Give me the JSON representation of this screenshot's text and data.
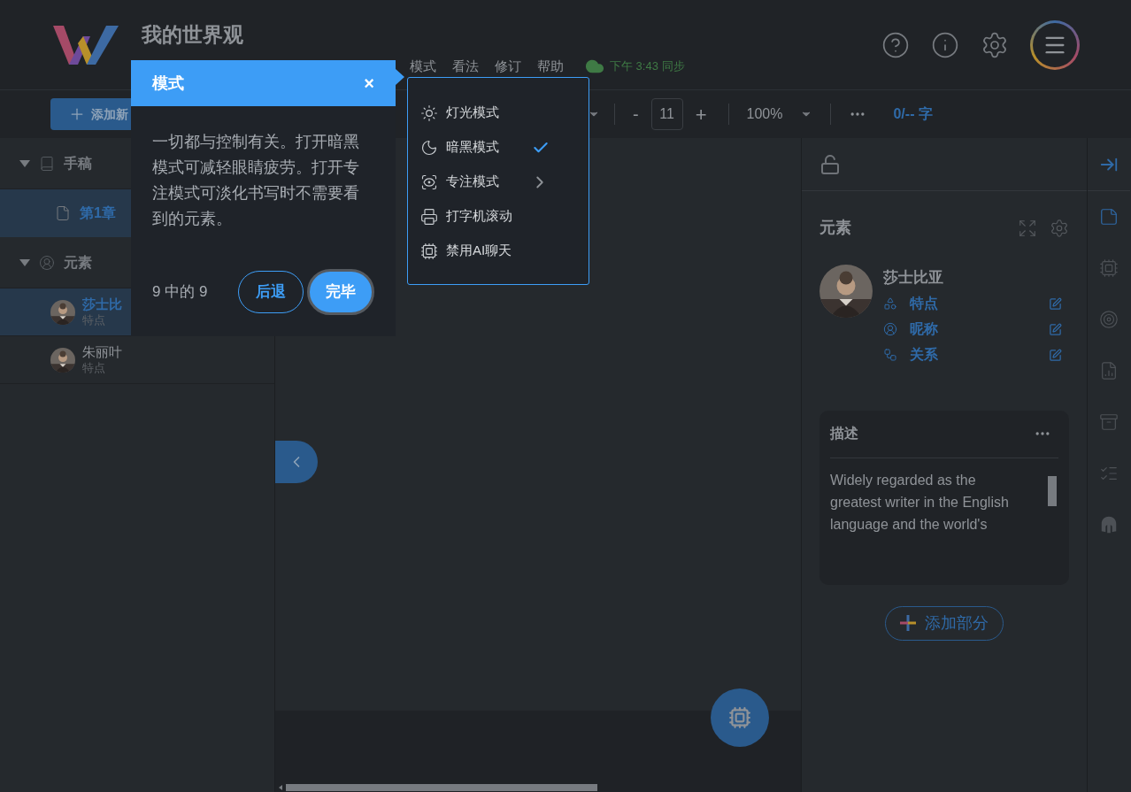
{
  "app": {
    "title": "我的世界观",
    "sync": "下午 3:43 同步"
  },
  "menu": [
    {
      "label": "模式"
    },
    {
      "label": "看法"
    },
    {
      "label": "修订"
    },
    {
      "label": "帮助"
    }
  ],
  "toolbar": {
    "add_button": "添加新",
    "decrease": "-",
    "font_size": "11",
    "increase": "+",
    "zoom": "100%",
    "word_count": "0/-- 字"
  },
  "sidebar": [
    {
      "label": "手稿",
      "kind": "manuscript",
      "expanded": true,
      "children": [
        {
          "label": "第1章",
          "kind": "chapter",
          "selected": true
        }
      ]
    },
    {
      "label": "元素",
      "kind": "elements",
      "expanded": true,
      "children": [
        {
          "label": "莎士比",
          "subtitle": "特点",
          "kind": "character",
          "selected": true
        },
        {
          "label": "朱丽叶",
          "subtitle": "特点",
          "kind": "character",
          "selected": false
        }
      ]
    }
  ],
  "tour": {
    "title": "模式",
    "close": "×",
    "body": "一切都与控制有关。打开暗黑模式可减轻眼睛疲劳。打开专注模式可淡化书写时不需要看到的元素。",
    "progress": "9 中的 9",
    "back": "后退",
    "done": "完毕"
  },
  "mode_menu": [
    {
      "kind": "light",
      "label": "灯光模式",
      "checked": false,
      "submenu": false
    },
    {
      "kind": "dark",
      "label": "暗黑模式",
      "checked": true,
      "submenu": false
    },
    {
      "kind": "focus",
      "label": "专注模式",
      "checked": false,
      "submenu": true
    },
    {
      "kind": "typewriter",
      "label": "打字机滚动",
      "checked": false,
      "submenu": false
    },
    {
      "kind": "ai",
      "label": "禁用AI聊天",
      "checked": false,
      "submenu": false
    }
  ],
  "elements_panel": {
    "title": "元素",
    "character": {
      "name": "莎士比亚",
      "fields": [
        {
          "kind": "traits",
          "label": "特点"
        },
        {
          "kind": "nickname",
          "label": "昵称"
        },
        {
          "kind": "relations",
          "label": "关系"
        }
      ]
    },
    "description": {
      "title": "描述",
      "text": "Widely regarded as the greatest writer in the English language and the world's"
    },
    "add_section": "添加部分"
  },
  "rail": [
    {
      "kind": "notes",
      "selected": true
    },
    {
      "kind": "ai",
      "selected": false
    },
    {
      "kind": "goals",
      "selected": false
    },
    {
      "kind": "stats",
      "selected": false
    },
    {
      "kind": "archive",
      "selected": false
    },
    {
      "kind": "tasks",
      "selected": false
    },
    {
      "kind": "helmet",
      "selected": false
    }
  ]
}
